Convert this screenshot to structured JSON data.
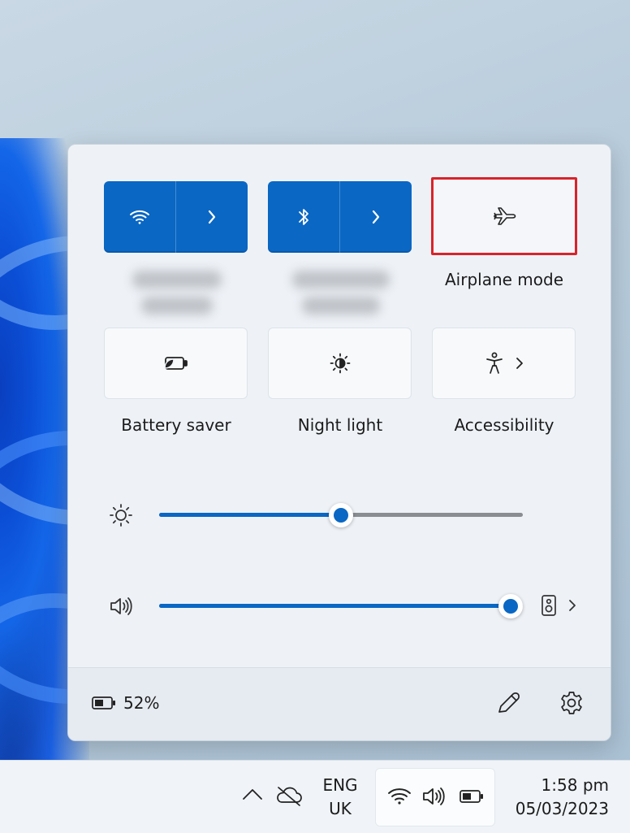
{
  "quick_settings": {
    "tiles": [
      {
        "id": "wifi",
        "label": "",
        "active": true,
        "icon": "wifi-icon"
      },
      {
        "id": "bluetooth",
        "label": "",
        "active": true,
        "icon": "bluetooth-icon"
      },
      {
        "id": "airplane",
        "label": "Airplane mode",
        "active": false,
        "icon": "airplane-icon"
      },
      {
        "id": "battery_saver",
        "label": "Battery saver",
        "active": false,
        "icon": "battery-saver-icon"
      },
      {
        "id": "night_light",
        "label": "Night light",
        "active": false,
        "icon": "night-light-icon"
      },
      {
        "id": "accessibility",
        "label": "Accessibility",
        "active": false,
        "icon": "accessibility-icon"
      }
    ],
    "brightness": {
      "value_percent": 50
    },
    "volume": {
      "value_percent": 100
    },
    "battery_text": "52%"
  },
  "taskbar": {
    "language_line1": "ENG",
    "language_line2": "UK",
    "time": "1:58 pm",
    "date": "05/03/2023"
  },
  "colors": {
    "accent": "#0a67c4",
    "highlight_border": "#d9232a"
  }
}
